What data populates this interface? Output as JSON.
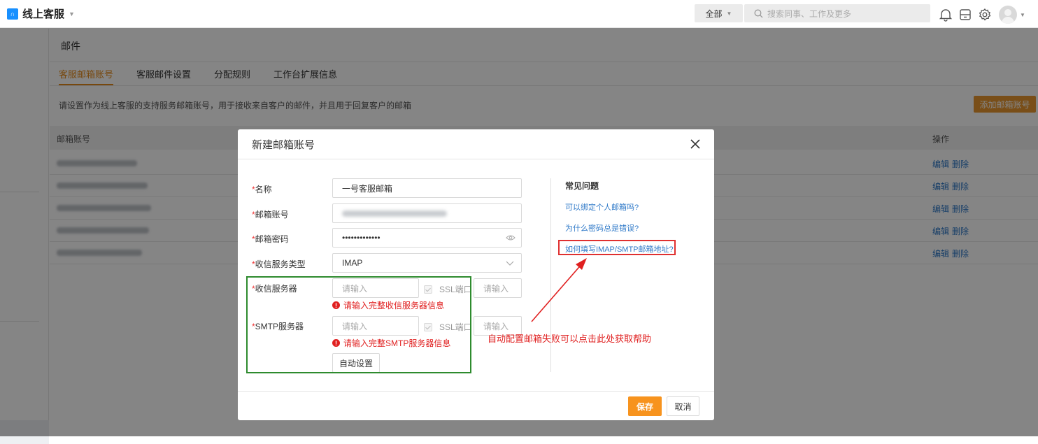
{
  "app": {
    "name": "线上客服",
    "scope": "全部",
    "search_placeholder": "搜索同事、工作及更多"
  },
  "page": {
    "title": "邮件",
    "tabs": [
      {
        "label": "客服邮箱账号",
        "active": true
      },
      {
        "label": "客服邮件设置",
        "active": false
      },
      {
        "label": "分配规则",
        "active": false
      },
      {
        "label": "工作台扩展信息",
        "active": false
      }
    ],
    "description": "请设置作为线上客服的支持服务邮箱账号，用于接收来自客户的邮件，并且用于回复客户的邮箱",
    "add_button": "添加邮箱账号",
    "table": {
      "headers": [
        "邮箱账号",
        "操作"
      ],
      "rows": [
        {
          "edit": "编辑",
          "delete": "删除"
        },
        {
          "edit": "编辑",
          "delete": "删除"
        },
        {
          "edit": "编辑",
          "delete": "删除"
        },
        {
          "edit": "编辑",
          "delete": "删除"
        },
        {
          "edit": "编辑",
          "delete": "删除"
        }
      ]
    }
  },
  "modal": {
    "title": "新建邮箱账号",
    "fields": {
      "name": {
        "label": "名称",
        "value": "一号客服邮箱"
      },
      "account": {
        "label": "邮箱账号"
      },
      "password": {
        "label": "邮箱密码",
        "value": "•••••••••••••"
      },
      "service_type": {
        "label": "收信服务类型",
        "value": "IMAP"
      },
      "incoming_server": {
        "label": "收信服务器",
        "placeholder": "请输入",
        "ssl_label": "SSL端口",
        "port_placeholder": "请输入",
        "error": "请输入完整收信服务器信息"
      },
      "smtp_server": {
        "label": "SMTP服务器",
        "placeholder": "请输入",
        "ssl_label": "SSL端口",
        "port_placeholder": "请输入",
        "error": "请输入完整SMTP服务器信息"
      }
    },
    "required_mark": "*",
    "auto_button": "自动设置",
    "faq": {
      "title": "常见问题",
      "items": [
        "可以绑定个人邮箱吗?",
        "为什么密码总是错误?",
        "如何填写IMAP/SMTP邮箱地址?"
      ]
    },
    "annotation": "自动配置邮箱失败可以点击此处获取帮助",
    "save_button": "保存",
    "cancel_button": "取消"
  },
  "colors": {
    "accent": "#f7931e",
    "link": "#2f79c8",
    "error": "#e02020",
    "highlight_green": "#2e8b2e",
    "highlight_red": "#e03030"
  }
}
